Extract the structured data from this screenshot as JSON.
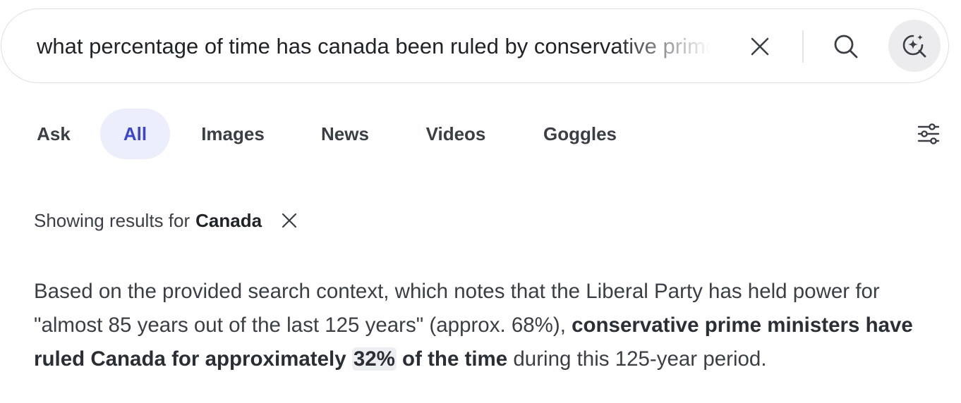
{
  "search": {
    "query": "what percentage of time has canada been ruled by conservative prime ministers"
  },
  "tabs": [
    {
      "label": "Ask",
      "active": false
    },
    {
      "label": "All",
      "active": true
    },
    {
      "label": "Images",
      "active": false
    },
    {
      "label": "News",
      "active": false
    },
    {
      "label": "Videos",
      "active": false
    },
    {
      "label": "Goggles",
      "active": false
    }
  ],
  "correction": {
    "prefix": "Showing results for",
    "term": "Canada"
  },
  "answer": {
    "part1": "Based on the provided search context, which notes that the Liberal Party has held power for \"almost 85 years out of the last 125 years\" (approx. 68%), ",
    "bold1": "conservative prime ministers have ruled Canada for approximately ",
    "highlight": "32%",
    "bold2": " of the time",
    "part2": " during this 125-year period."
  },
  "icons": {
    "clear": "close-icon",
    "search": "search-icon",
    "ai": "ai-sparkle-search-icon",
    "filters": "sliders-icon",
    "dismiss": "close-icon"
  },
  "colors": {
    "accent": "#3b46c8",
    "active_tab_bg": "#eceefb"
  }
}
